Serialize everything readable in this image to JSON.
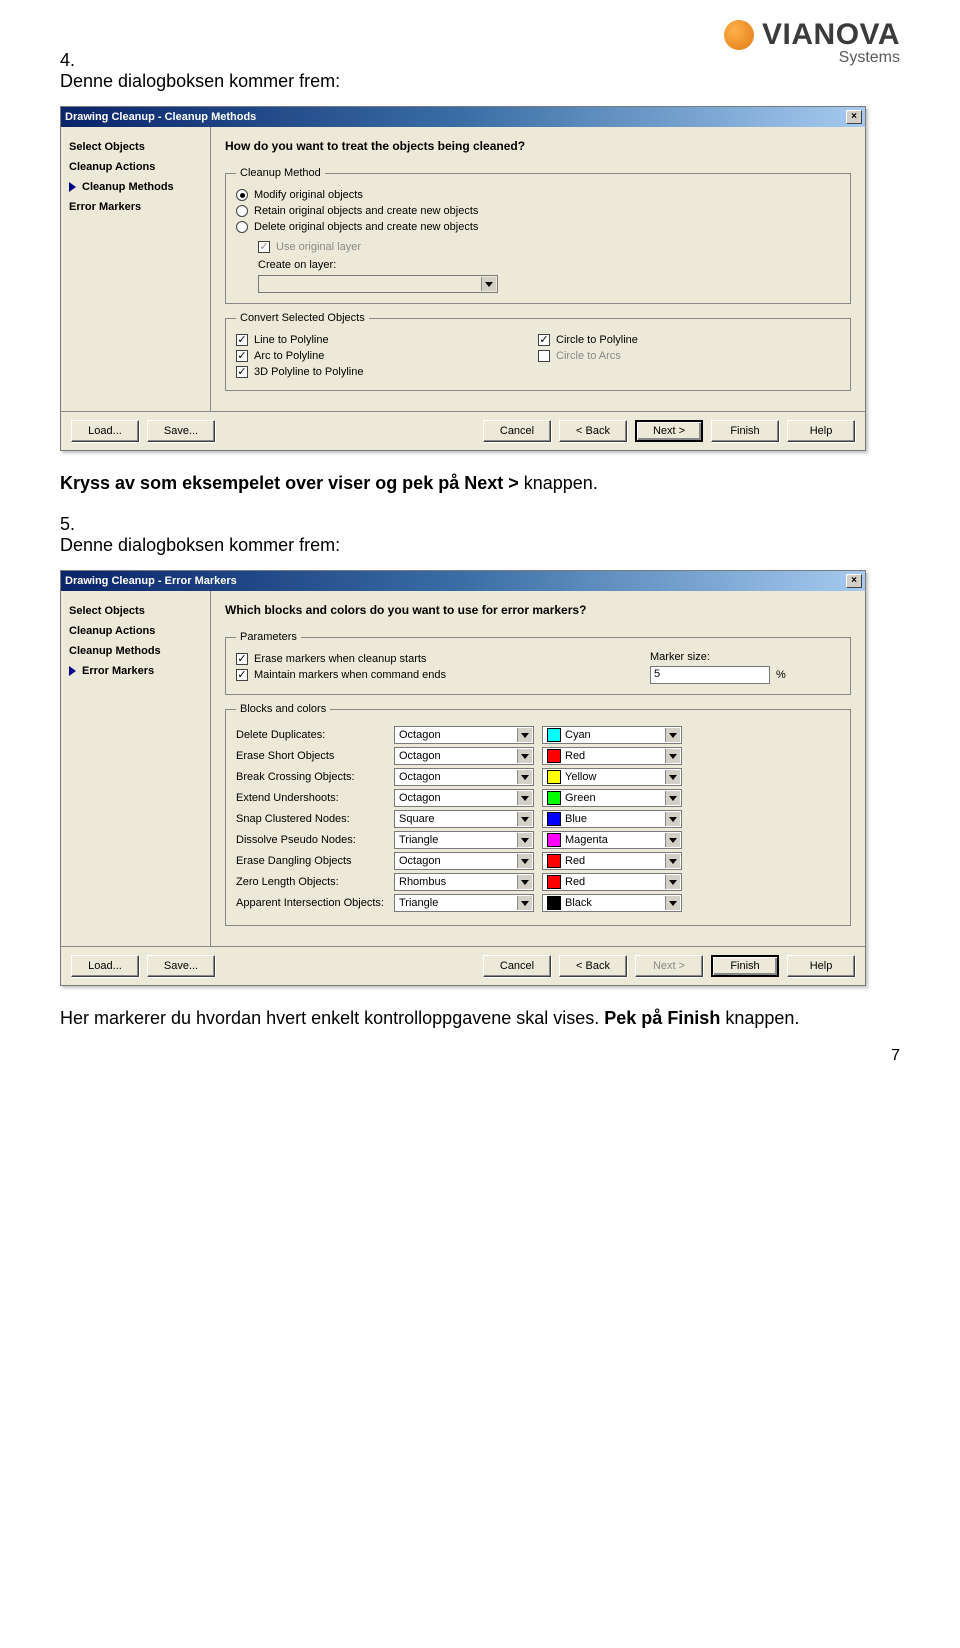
{
  "brand": {
    "name": "VIANOVA",
    "sub": "Systems"
  },
  "page_number": "7",
  "text": {
    "item4_num": "4.",
    "item4_text": "Denne dialogboksen kommer frem:",
    "item4_post_pre": "Kryss av som eksempelet over viser og pek på ",
    "item4_post_btn": "Next >",
    "item4_post_suffix": " knappen.",
    "item5_num": "5.",
    "item5_text": "Denne dialogboksen kommer frem:",
    "final_pre": "Her markerer du hvordan hvert enkelt kontrolloppgavene skal vises. ",
    "final_pek": "Pek på Finish",
    "final_suffix": " knappen."
  },
  "dlg1": {
    "title": "Drawing Cleanup - Cleanup Methods",
    "close": "×",
    "sidebar": [
      "Select Objects",
      "Cleanup Actions",
      "Cleanup Methods",
      "Error Markers"
    ],
    "active_idx": 2,
    "heading": "How do you want to treat the objects being cleaned?",
    "fs1_legend": "Cleanup Method",
    "radios": [
      "Modify original objects",
      "Retain original objects and create new objects",
      "Delete original objects and create new objects"
    ],
    "radio_sel": 0,
    "use_original": "Use original layer",
    "create_on": "Create on layer:",
    "fs2_legend": "Convert Selected Objects",
    "checks": {
      "line": "Line to Polyline",
      "arc": "Arc to Polyline",
      "poly3d": "3D Polyline to Polyline",
      "circle_poly": "Circle to Polyline",
      "circle_arcs": "Circle to Arcs"
    },
    "footer": {
      "load": "Load...",
      "save": "Save...",
      "cancel": "Cancel",
      "back": "< Back",
      "next": "Next >",
      "finish": "Finish",
      "help": "Help"
    }
  },
  "dlg2": {
    "title": "Drawing Cleanup - Error Markers",
    "close": "×",
    "sidebar": [
      "Select Objects",
      "Cleanup Actions",
      "Cleanup Methods",
      "Error Markers"
    ],
    "active_idx": 3,
    "heading": "Which blocks and colors do you want to use for error markers?",
    "fs1_legend": "Parameters",
    "erase_check": "Erase markers when cleanup starts",
    "maintain_check": "Maintain markers when command ends",
    "marker_size_lbl": "Marker size:",
    "marker_size_val": "5",
    "marker_size_unit": "%",
    "fs2_legend": "Blocks and colors",
    "rows": [
      {
        "label": "Delete Duplicates:",
        "shape": "Octagon",
        "color_name": "Cyan",
        "color": "#00ffff"
      },
      {
        "label": "Erase Short Objects",
        "shape": "Octagon",
        "color_name": "Red",
        "color": "#ff0000"
      },
      {
        "label": "Break Crossing Objects:",
        "shape": "Octagon",
        "color_name": "Yellow",
        "color": "#ffff00"
      },
      {
        "label": "Extend Undershoots:",
        "shape": "Octagon",
        "color_name": "Green",
        "color": "#00ff00"
      },
      {
        "label": "Snap Clustered Nodes:",
        "shape": "Square",
        "color_name": "Blue",
        "color": "#0000ff"
      },
      {
        "label": "Dissolve Pseudo Nodes:",
        "shape": "Triangle",
        "color_name": "Magenta",
        "color": "#ff00ff"
      },
      {
        "label": "Erase Dangling Objects",
        "shape": "Octagon",
        "color_name": "Red",
        "color": "#ff0000"
      },
      {
        "label": "Zero Length Objects:",
        "shape": "Rhombus",
        "color_name": "Red",
        "color": "#ff0000"
      },
      {
        "label": "Apparent Intersection Objects:",
        "shape": "Triangle",
        "color_name": "Black",
        "color": "#000000"
      }
    ],
    "footer": {
      "load": "Load...",
      "save": "Save...",
      "cancel": "Cancel",
      "back": "< Back",
      "next": "Next >",
      "finish": "Finish",
      "help": "Help"
    }
  }
}
